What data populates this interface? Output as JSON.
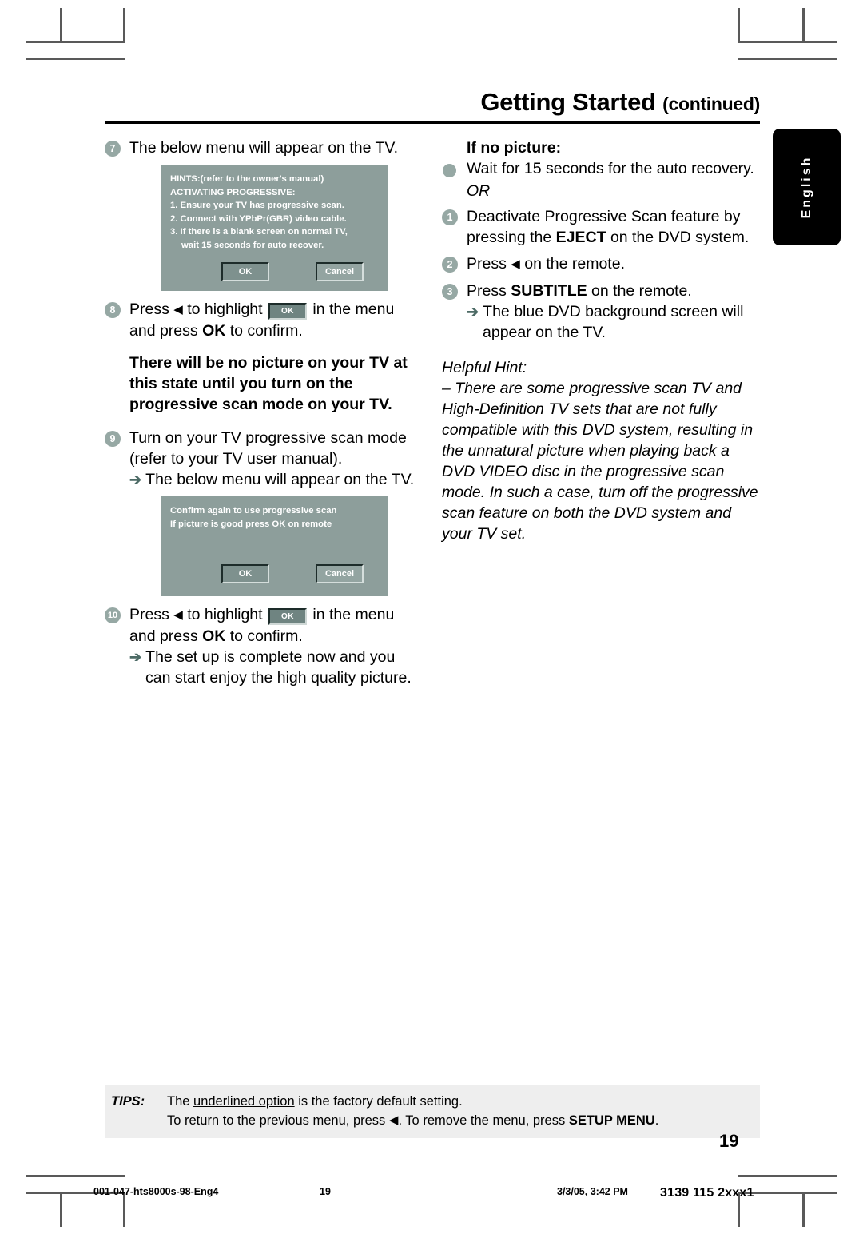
{
  "header": {
    "title_main": "Getting Started",
    "title_sub": "(continued)"
  },
  "side_tab": {
    "label": "English"
  },
  "left_column": {
    "step7": {
      "number": "7",
      "text": "The below menu will appear on the TV."
    },
    "menu_box_1": {
      "lines": [
        "HINTS:(refer to the owner's manual)",
        "ACTIVATING PROGRESSIVE:",
        "1. Ensure your TV has progressive scan.",
        "2. Connect with YPbPr(GBR) video cable.",
        "3. If there is a blank screen on normal TV,"
      ],
      "indented_line": "wait 15 seconds for auto recover.",
      "ok_label": "OK",
      "cancel_label": "Cancel"
    },
    "step8": {
      "number": "8",
      "text_a": "Press",
      "triangle": "◀",
      "text_b": "to highlight",
      "chip_label": "OK",
      "text_c": "in the menu",
      "line2_a": "and press",
      "line2_bold": "OK",
      "line2_b": "to confirm."
    },
    "warning": "There will be no picture on your TV at this state until you turn on the progressive scan mode on your TV.",
    "step9": {
      "number": "9",
      "line1": "Turn on your TV progressive scan mode",
      "line2": "(refer to your TV user manual).",
      "arrow": "➔",
      "line3": "The below menu will appear on the TV."
    },
    "menu_box_2": {
      "lines": [
        "Confirm again to use progressive scan",
        "If picture is good press OK on remote"
      ],
      "ok_label": "OK",
      "cancel_label": "Cancel"
    },
    "step10": {
      "number": "10",
      "text_a": "Press",
      "triangle": "◀",
      "text_b": "to highlight",
      "chip_label": "OK",
      "text_c": "in the menu",
      "line2_a": "and press",
      "line2_bold": "OK",
      "line2_b": "to confirm.",
      "arrow": "➔",
      "line3": "The set up is complete now and you",
      "line4": "can start enjoy the high quality picture."
    }
  },
  "right_column": {
    "heading": "If no picture:",
    "bullet": {
      "text": "Wait for 15 seconds for the auto recovery."
    },
    "or_label": "OR",
    "step1": {
      "number": "1",
      "line1_a": "Deactivate Progressive Scan feature by",
      "line2_a": "pressing the",
      "line2_bold": "EJECT",
      "line2_b": "on the DVD system."
    },
    "step2": {
      "number": "2",
      "text_a": "Press",
      "triangle": "◀",
      "text_b": "on the remote."
    },
    "step3": {
      "number": "3",
      "text_a": "Press",
      "text_bold": "SUBTITLE",
      "text_b": "on the remote.",
      "arrow": "➔",
      "line2": "The blue DVD background screen will",
      "line3": "appear on the TV."
    },
    "helpful_hint": {
      "title": "Helpful Hint:",
      "body": "–  There are some progressive scan TV and High-Definition TV sets that are not fully compatible with this DVD system, resulting in the unnatural picture when playing back a DVD VIDEO disc in the progressive scan mode.  In such a case, turn off the progressive scan feature on both the DVD system and your TV set."
    }
  },
  "tips": {
    "label": "TIPS:",
    "line1_a": "The ",
    "line1_underline": "underlined option",
    "line1_b": " is the factory default setting.",
    "line2_a": "To return to the previous menu, press ",
    "line2_triangle": "◀",
    "line2_b": ". To remove the menu, press ",
    "line2_bold": "SETUP MENU",
    "line2_c": "."
  },
  "page_number": "19",
  "imprint": {
    "file": "001-047-hts8000s-98-Eng4",
    "page": "19",
    "date": "3/3/05, 3:42 PM",
    "code": "3139 115 2xxx1"
  },
  "colors": {
    "accent_gray_green": "#96a8a4",
    "menu_bg": "#8d9e9b",
    "tab_bg": "#000000",
    "tips_bg": "#eeeeee"
  }
}
